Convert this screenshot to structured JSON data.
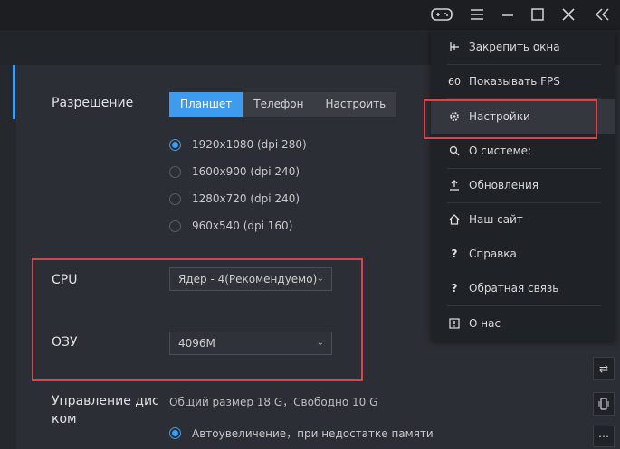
{
  "titlebar": {
    "icons": [
      "gamepad-icon",
      "hamburger-menu-icon",
      "minimize-icon",
      "maximize-icon",
      "close-icon",
      "collapse-icon"
    ]
  },
  "settings": {
    "resolution_label": "Разрешение",
    "resolution_tabs": [
      "Планшет",
      "Телефон",
      "Настроить"
    ],
    "resolution_active": "Планшет",
    "resolutions": [
      {
        "label": "1920x1080  (dpi 280)",
        "selected": true
      },
      {
        "label": "1600x900  (dpi 240)",
        "selected": false
      },
      {
        "label": "1280x720  (dpi 240)",
        "selected": false
      },
      {
        "label": "960x540  (dpi 160)",
        "selected": false
      }
    ],
    "cpu_label": "CPU",
    "cpu_value": "Ядер - 4(Рекомендуемо)",
    "ram_label": "ОЗУ",
    "ram_value": "4096M",
    "disk_label_1": "Управление дис",
    "disk_label_2": "ком",
    "disk_info": "Общий размер 18 G，Свободно 10 G",
    "disk_auto": "Автоувеличение，при недостатке памяти"
  },
  "menu": {
    "items": [
      {
        "label": "Закрепить окна",
        "icon": "pin-icon"
      },
      {
        "label": "Показывать FPS",
        "icon": "fps-icon"
      },
      {
        "label": "Настройки",
        "icon": "gear-icon"
      },
      {
        "label": "О системе:",
        "icon": "search-icon"
      },
      {
        "label": "Обновления",
        "icon": "upload-icon"
      },
      {
        "label": "Наш сайт",
        "icon": "home-icon"
      },
      {
        "label": "Справка",
        "icon": "help-icon"
      },
      {
        "label": "Обратная связь",
        "icon": "feedback-icon"
      },
      {
        "label": "О нас",
        "icon": "info-icon"
      }
    ],
    "highlighted": "Настройки"
  },
  "colors": {
    "accent": "#3d9bf0",
    "highlight_border": "#d9444a"
  }
}
